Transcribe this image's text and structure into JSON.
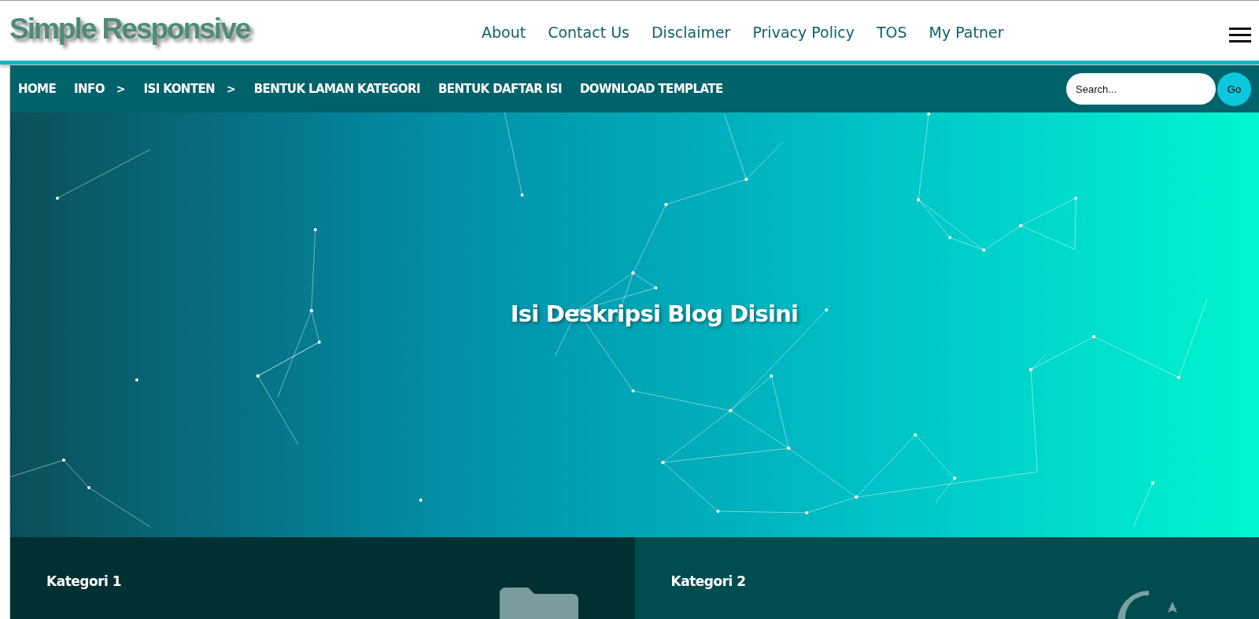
{
  "header": {
    "logo": "Simple Responsive",
    "links": [
      "About",
      "Contact Us",
      "Disclaimer",
      "Privacy Policy",
      "TOS",
      "My Patner"
    ]
  },
  "nav": {
    "items": [
      {
        "label": "HOME"
      },
      {
        "label": "INFO",
        "marker": ">"
      },
      {
        "label": "ISI KONTEN",
        "marker": ">"
      },
      {
        "label": "BENTUK LAMAN KATEGORI"
      },
      {
        "label": "BENTUK DAFTAR ISI"
      },
      {
        "label": "DOWNLOAD TEMPLATE"
      }
    ],
    "search": {
      "placeholder": "Search...",
      "button": "Go"
    }
  },
  "hero": {
    "description": "Isi Deskripsi Blog Disini"
  },
  "categories": [
    {
      "title": "Kategori 1",
      "kind": "folder"
    },
    {
      "title": "Kategori 2",
      "kind": "moon"
    }
  ]
}
